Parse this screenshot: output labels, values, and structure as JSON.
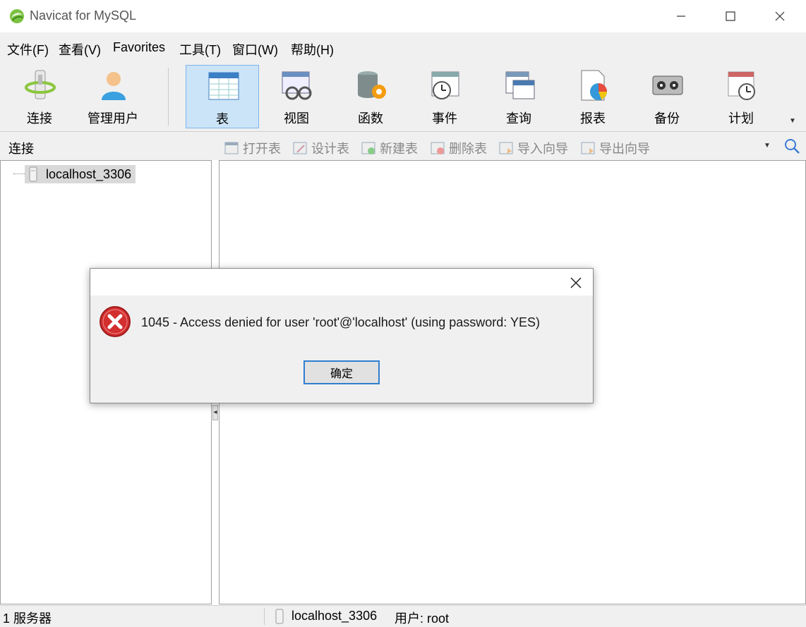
{
  "window": {
    "title": "Navicat for MySQL",
    "icon": "navicat-logo-icon",
    "controls": [
      "minimize-icon",
      "maximize-icon",
      "close-icon"
    ]
  },
  "menu": {
    "items": [
      {
        "label": "文件(F)"
      },
      {
        "label": "查看(V)"
      },
      {
        "label": "Favorites"
      },
      {
        "label": "工具(T)"
      },
      {
        "label": "窗口(W)"
      },
      {
        "label": "帮助(H)"
      }
    ]
  },
  "toolbar": {
    "buttons": [
      {
        "label": "连接",
        "icon": "connection-icon"
      },
      {
        "label": "管理用户",
        "icon": "user-icon"
      },
      {
        "label": "表",
        "icon": "table-icon",
        "active": true
      },
      {
        "label": "视图",
        "icon": "view-icon"
      },
      {
        "label": "函数",
        "icon": "function-icon"
      },
      {
        "label": "事件",
        "icon": "event-icon"
      },
      {
        "label": "查询",
        "icon": "query-icon"
      },
      {
        "label": "报表",
        "icon": "report-icon"
      },
      {
        "label": "备份",
        "icon": "backup-icon"
      },
      {
        "label": "计划",
        "icon": "schedule-icon"
      }
    ]
  },
  "subbar": {
    "connection_label": "连接",
    "actions": [
      {
        "label": "打开表",
        "icon": "open-table-icon"
      },
      {
        "label": "设计表",
        "icon": "design-table-icon"
      },
      {
        "label": "新建表",
        "icon": "new-table-icon"
      },
      {
        "label": "删除表",
        "icon": "delete-table-icon"
      },
      {
        "label": "导入向导",
        "icon": "import-wizard-icon"
      },
      {
        "label": "导出向导",
        "icon": "export-wizard-icon"
      }
    ],
    "search_icon": "search-icon"
  },
  "tree": {
    "items": [
      {
        "label": "localhost_3306",
        "icon": "server-icon"
      }
    ]
  },
  "status": {
    "server_count": "1 服务器",
    "connection": "localhost_3306",
    "user": "用户: root"
  },
  "dialog": {
    "icon": "error-icon",
    "message": "1045 - Access denied for user 'root'@'localhost' (using password: YES)",
    "ok_label": "确定"
  },
  "colors": {
    "active_tool_bg": "#cce4f7",
    "active_tool_border": "#7eb4ea",
    "error_red": "#d32f2f",
    "ok_border": "#2f7fd0"
  }
}
